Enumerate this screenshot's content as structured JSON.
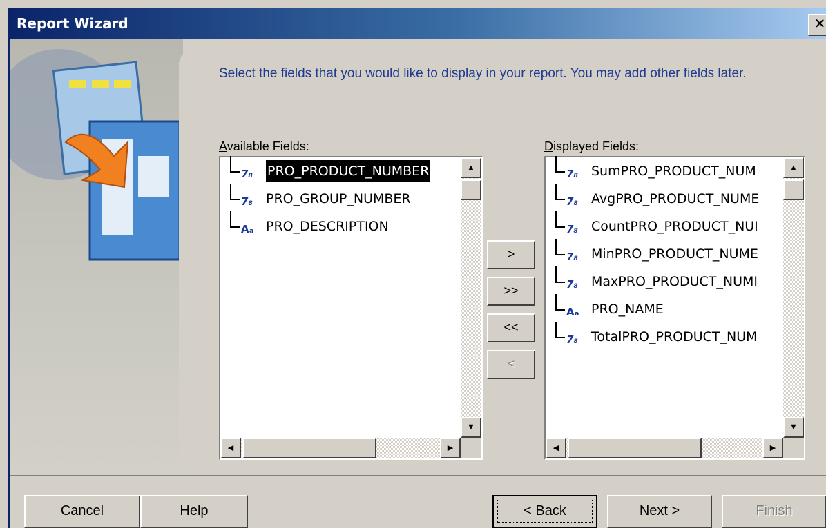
{
  "window": {
    "title": "Report Wizard",
    "close_label": "✕"
  },
  "instructions": "Select the fields that you would like to display in your report. You may add other fields later.",
  "available": {
    "label_accel": "A",
    "label_rest": "vailable Fields:",
    "items": [
      {
        "icon": "7₈",
        "label": "PRO_PRODUCT_NUMBER",
        "type": "numeric"
      },
      {
        "icon": "7₈",
        "label": "PRO_GROUP_NUMBER",
        "type": "numeric"
      },
      {
        "icon": "Aₐ",
        "label": "PRO_DESCRIPTION",
        "type": "text"
      }
    ]
  },
  "displayed": {
    "label_accel": "D",
    "label_rest": "isplayed Fields:",
    "items": [
      {
        "icon": "7₈",
        "label": "SumPRO_PRODUCT_NUM",
        "type": "numeric"
      },
      {
        "icon": "7₈",
        "label": "AvgPRO_PRODUCT_NUME",
        "type": "numeric"
      },
      {
        "icon": "7₈",
        "label": "CountPRO_PRODUCT_NUI",
        "type": "numeric"
      },
      {
        "icon": "7₈",
        "label": "MinPRO_PRODUCT_NUME",
        "type": "numeric"
      },
      {
        "icon": "7₈",
        "label": "MaxPRO_PRODUCT_NUMI",
        "type": "numeric"
      },
      {
        "icon": "Aₐ",
        "label": "PRO_NAME",
        "type": "text"
      },
      {
        "icon": "7₈",
        "label": "TotalPRO_PRODUCT_NUM",
        "type": "numeric"
      }
    ]
  },
  "move": {
    "add_one": ">",
    "add_all": ">>",
    "remove_all": "<<",
    "remove_one": "<"
  },
  "scroll": {
    "up": "▲",
    "down": "▼",
    "left": "◀",
    "right": "▶"
  },
  "buttons": {
    "cancel": "Cancel",
    "help": "Help",
    "back": "< Back",
    "next": "Next >",
    "finish": "Finish"
  },
  "colors": {
    "titlebar_start": "#0a246a",
    "titlebar_end": "#a6caf0",
    "instruction_text": "#1f3a8f",
    "icon": "#1a3a9a"
  }
}
